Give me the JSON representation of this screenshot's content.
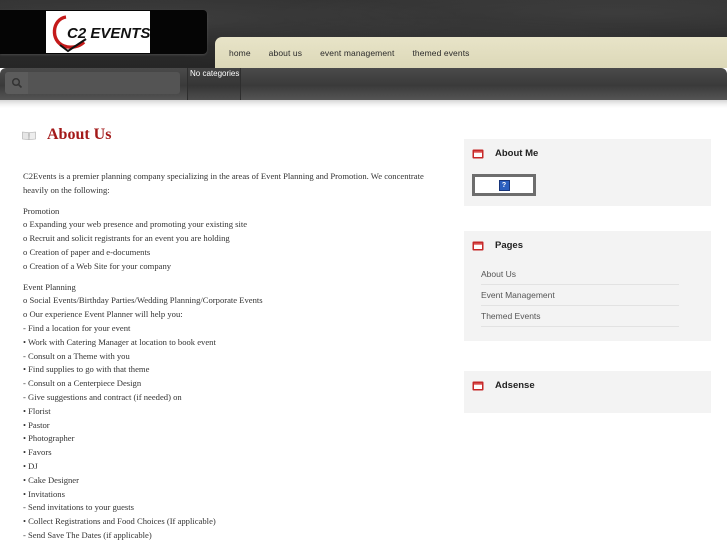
{
  "header": {
    "logo_text": "C2 EVENTS"
  },
  "nav": {
    "items": [
      {
        "label": "home"
      },
      {
        "label": "about us"
      },
      {
        "label": "event management"
      },
      {
        "label": "themed events"
      }
    ]
  },
  "toolbar": {
    "search_placeholder": "",
    "categories_label": "No categories"
  },
  "page": {
    "title": "About Us",
    "intro": [
      "C2Events is a premier planning company specializing in the areas of Event Planning and Promotion. We concentrate",
      "heavily on the following:"
    ],
    "promotion": [
      "Promotion",
      "o Expanding your web presence and promoting your existing site",
      "o Recruit and solicit registrants for an event you are holding",
      "o Creation of paper and e-documents",
      "o Creation of a Web Site for your company"
    ],
    "event_planning": [
      "Event Planning",
      "o Social Events/Birthday Parties/Wedding Planning/Corporate Events",
      "o Our experience Event Planner will help you:",
      "- Find a location for your event",
      "• Work with Catering Manager at location to book event",
      "- Consult on a Theme with you",
      "• Find supplies to go with that theme",
      "- Consult on a Centerpiece Design",
      "- Give suggestions and contract (if needed) on",
      "• Florist",
      "• Pastor",
      "• Photographer",
      "• Favors",
      "• DJ",
      "• Cake Designer",
      "• Invitations",
      "- Send invitations to your guests",
      "• Collect Registrations and Food Choices (If applicable)",
      "- Send Save The Dates (if applicable)"
    ]
  },
  "sidebar": {
    "about_me": {
      "title": "About Me",
      "image_glyph": "?"
    },
    "pages": {
      "title": "Pages",
      "items": [
        {
          "label": "About Us"
        },
        {
          "label": "Event Management"
        },
        {
          "label": "Themed Events"
        }
      ]
    },
    "adsense": {
      "title": "Adsense"
    }
  },
  "colors": {
    "title_red": "#a31919",
    "nav_bg": "#e8e4c8",
    "header_dark": "#2b2b2b",
    "widget_bg": "#f3f3f3",
    "widget_icon": "#c62828"
  },
  "icons": {
    "search": "search-icon",
    "page_title": "book-icon",
    "widget": "folder-icon"
  }
}
